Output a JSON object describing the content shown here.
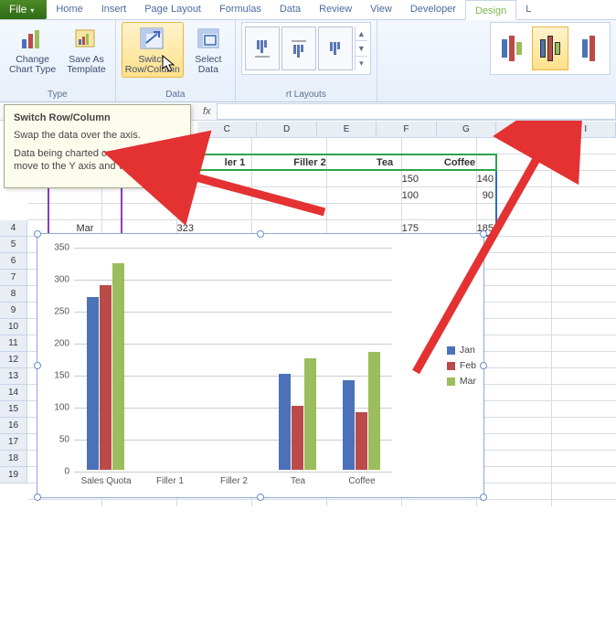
{
  "tabs": {
    "file": "File",
    "items": [
      "Home",
      "Insert",
      "Page Layout",
      "Formulas",
      "Data",
      "Review",
      "View",
      "Developer",
      "Design",
      "L"
    ]
  },
  "ribbon": {
    "type": {
      "label": "Type",
      "change": "Change\nChart Type",
      "save": "Save As\nTemplate"
    },
    "data": {
      "label": "Data",
      "switch": "Switch\nRow/Column",
      "select": "Select\nData"
    },
    "layouts": "rt Layouts"
  },
  "tooltip": {
    "title": "Switch Row/Column",
    "p1": "Swap the data over the axis.",
    "p2": "Data being charted on the X axis will move to the Y axis and vice versa."
  },
  "fx": "fx",
  "cols": [
    "C",
    "D",
    "E",
    "F",
    "G",
    "H",
    "I"
  ],
  "rows": [
    "4",
    "5",
    "6",
    "7",
    "8",
    "9",
    "10",
    "11",
    "12",
    "13",
    "14",
    "15",
    "16",
    "17",
    "18",
    "19"
  ],
  "sheet": {
    "h": {
      "c": "ler 1",
      "d": "Filler 2",
      "e": "Tea",
      "f": "Coffee"
    },
    "r2": {
      "e": "150",
      "f": "140"
    },
    "r3": {
      "e": "100",
      "f": "90"
    },
    "r4": {
      "a": "Mar",
      "b": "323",
      "e": "175",
      "f": "185"
    }
  },
  "chart_data": {
    "type": "bar",
    "title": "",
    "xlabel": "",
    "ylabel": "",
    "ylim": [
      0,
      350
    ],
    "yticks": [
      0,
      50,
      100,
      150,
      200,
      250,
      300,
      350
    ],
    "categories": [
      "Sales Quota",
      "Filler 1",
      "Filler 2",
      "Tea",
      "Coffee"
    ],
    "series": [
      {
        "name": "Jan",
        "color": "#4a72b8",
        "values": [
          270,
          0,
          0,
          150,
          140
        ]
      },
      {
        "name": "Feb",
        "color": "#bb4b49",
        "values": [
          289,
          0,
          0,
          100,
          90
        ]
      },
      {
        "name": "Mar",
        "color": "#9cbd5c",
        "values": [
          323,
          0,
          0,
          175,
          185
        ]
      }
    ]
  }
}
